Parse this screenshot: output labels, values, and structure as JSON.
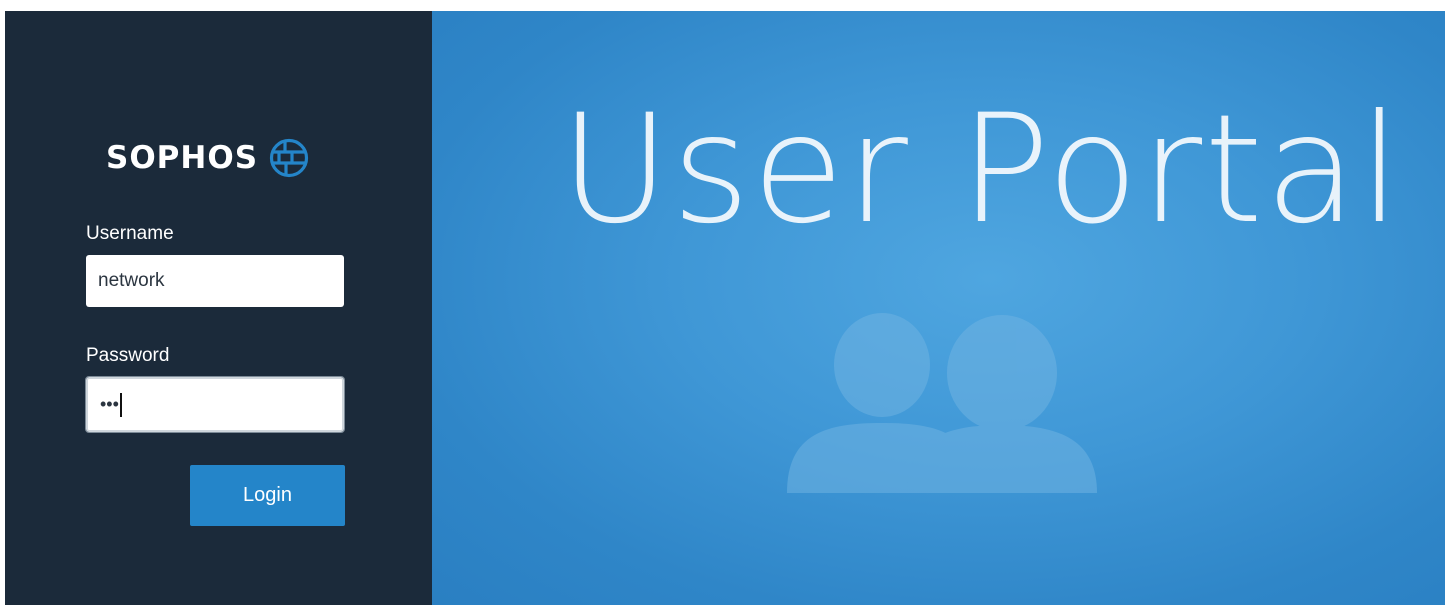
{
  "brand": {
    "name": "SOPHOS",
    "logo_icon": "globe-icon"
  },
  "login_form": {
    "username_label": "Username",
    "username_value": "network",
    "password_label": "Password",
    "password_value": "•••",
    "login_button": "Login"
  },
  "hero": {
    "title": "User Portal",
    "graphic_icon": "users-icon"
  },
  "colors": {
    "sidebar": "#1b2a3a",
    "accent": "#2485c9",
    "hero_blue": "#3f97d6"
  }
}
